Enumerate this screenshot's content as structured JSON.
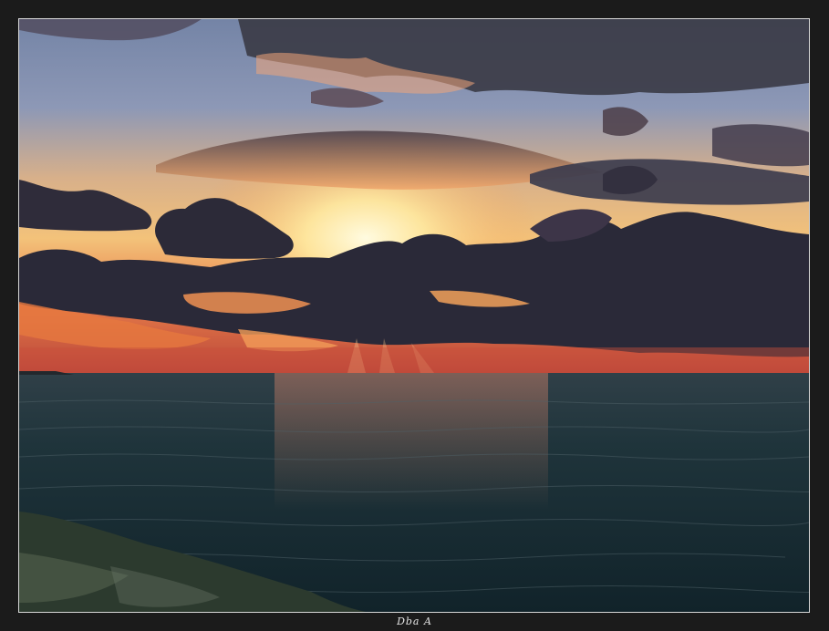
{
  "signature": {
    "text": "Dba A"
  },
  "colors": {
    "frame": "#1b1b1b",
    "border": "#d8d8d8",
    "sky_top": "#6f7fa3",
    "sky_mid": "#d79a6a",
    "sun_glow": "#fff2b0",
    "horizon": "#e0643a",
    "cloud_dark": "#2d2b3a",
    "sea": "#1c3138",
    "shore": "#2f3a30"
  }
}
